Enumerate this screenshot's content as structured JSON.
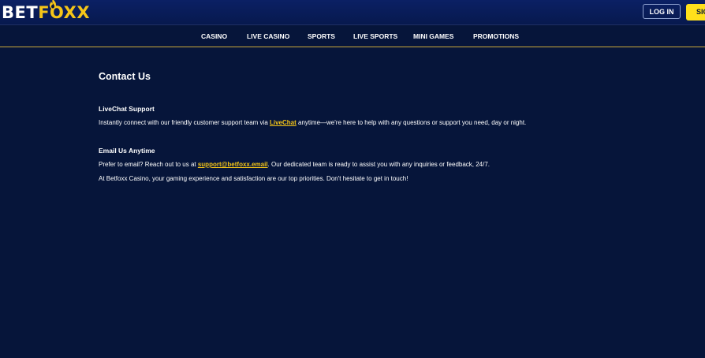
{
  "brand": {
    "logo_part1": "BET",
    "logo_part2": "FOXX",
    "accent_color": "#f5c518",
    "flame_icon": "flame-icon"
  },
  "header": {
    "login_label": "LOG IN",
    "signup_label": "SIGN UP"
  },
  "nav": {
    "items": [
      {
        "label": "CASINO"
      },
      {
        "label": "LIVE CASINO"
      },
      {
        "label": "SPORTS"
      },
      {
        "label": "LIVE SPORTS"
      },
      {
        "label": "MINI GAMES"
      },
      {
        "label": "PROMOTIONS"
      }
    ]
  },
  "main": {
    "title": "Contact Us",
    "livechat": {
      "heading": "LiveChat Support",
      "text_before": "Instantly connect with our friendly customer support team via ",
      "link": "LiveChat",
      "text_after": " anytime—we're here to help with any questions or support you need, day or night."
    },
    "email": {
      "heading": "Email Us Anytime",
      "text_before": "Prefer to email? Reach out to us at ",
      "link": "support@betfoxx.email",
      "text_after": ". Our dedicated team is ready to assist you with any inquiries or feedback, 24/7."
    },
    "closing": "At Betfoxx Casino, your gaming experience and satisfaction are our top priorities. Don't hesitate to get in touch!"
  },
  "colors": {
    "background": "#06153a",
    "header": "#0b2064",
    "signup": "#ffe01b",
    "nav_border": "#c9a83a"
  }
}
